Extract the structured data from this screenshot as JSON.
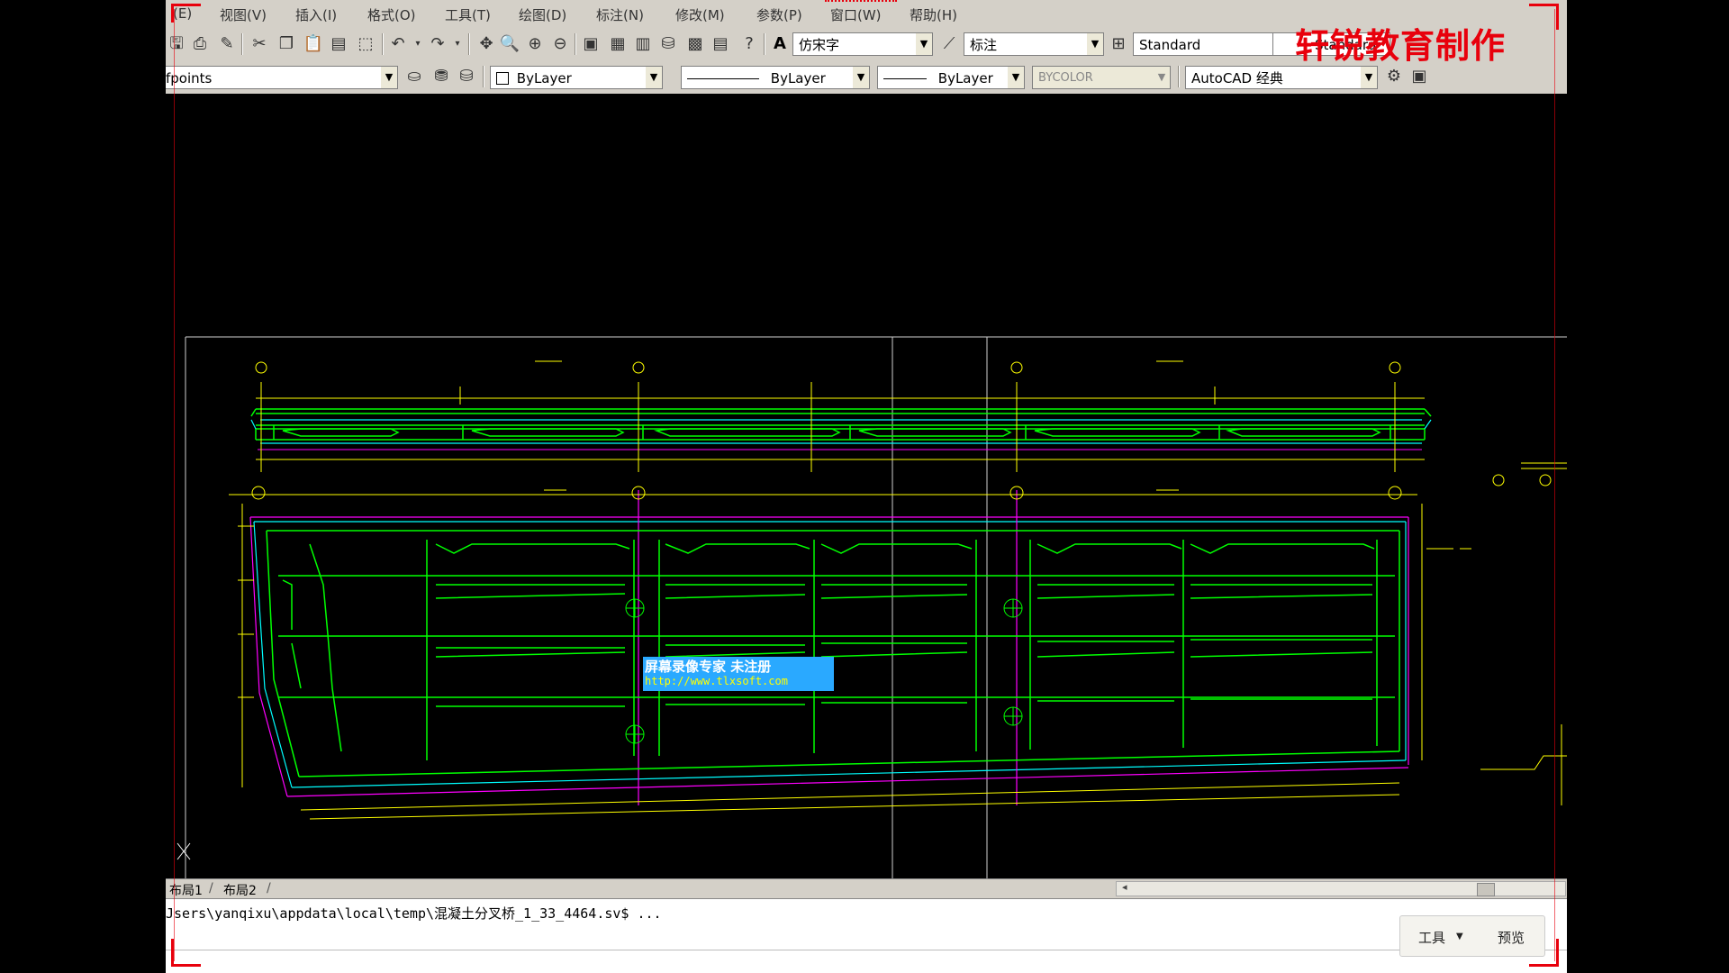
{
  "menu": [
    "(E)",
    "视图(V)",
    "插入(I)",
    "格式(O)",
    "工具(T)",
    "绘图(D)",
    "标注(N)",
    "修改(M)",
    "参数(P)",
    "窗口(W)",
    "帮助(H)"
  ],
  "toolbar1": {
    "text_style": "仿宋字",
    "dim_style": "标注",
    "table_style": "Standard",
    "multileader_style": "Standard"
  },
  "toolbar2": {
    "layer": "fpoints",
    "color": "ByLayer",
    "linetype": "ByLayer",
    "lineweight": "ByLayer",
    "plot_style": "BYCOLOR",
    "workspace": "AutoCAD 经典"
  },
  "watermark": "轩锐教育制作",
  "recorder_logo": {
    "line1": "屏幕录像专家     未注册",
    "line2": "http://www.tlxsoft.com"
  },
  "layout_tabs": [
    "布局1",
    "布局2"
  ],
  "command_line": "Jsers\\yanqixu\\appdata\\local\\temp\\混凝土分叉桥_1_33_4464.sv$ ...",
  "command_buttons": {
    "tools": "工具",
    "preview": "预览"
  },
  "colors": {
    "chrome": "#d4d0c8",
    "canvas": "#000000",
    "drawing_green": "#00ff00",
    "drawing_yellow": "#ffff00",
    "drawing_cyan": "#00ffff",
    "drawing_magenta": "#ff00ff",
    "watermark_red": "#e8000c"
  }
}
